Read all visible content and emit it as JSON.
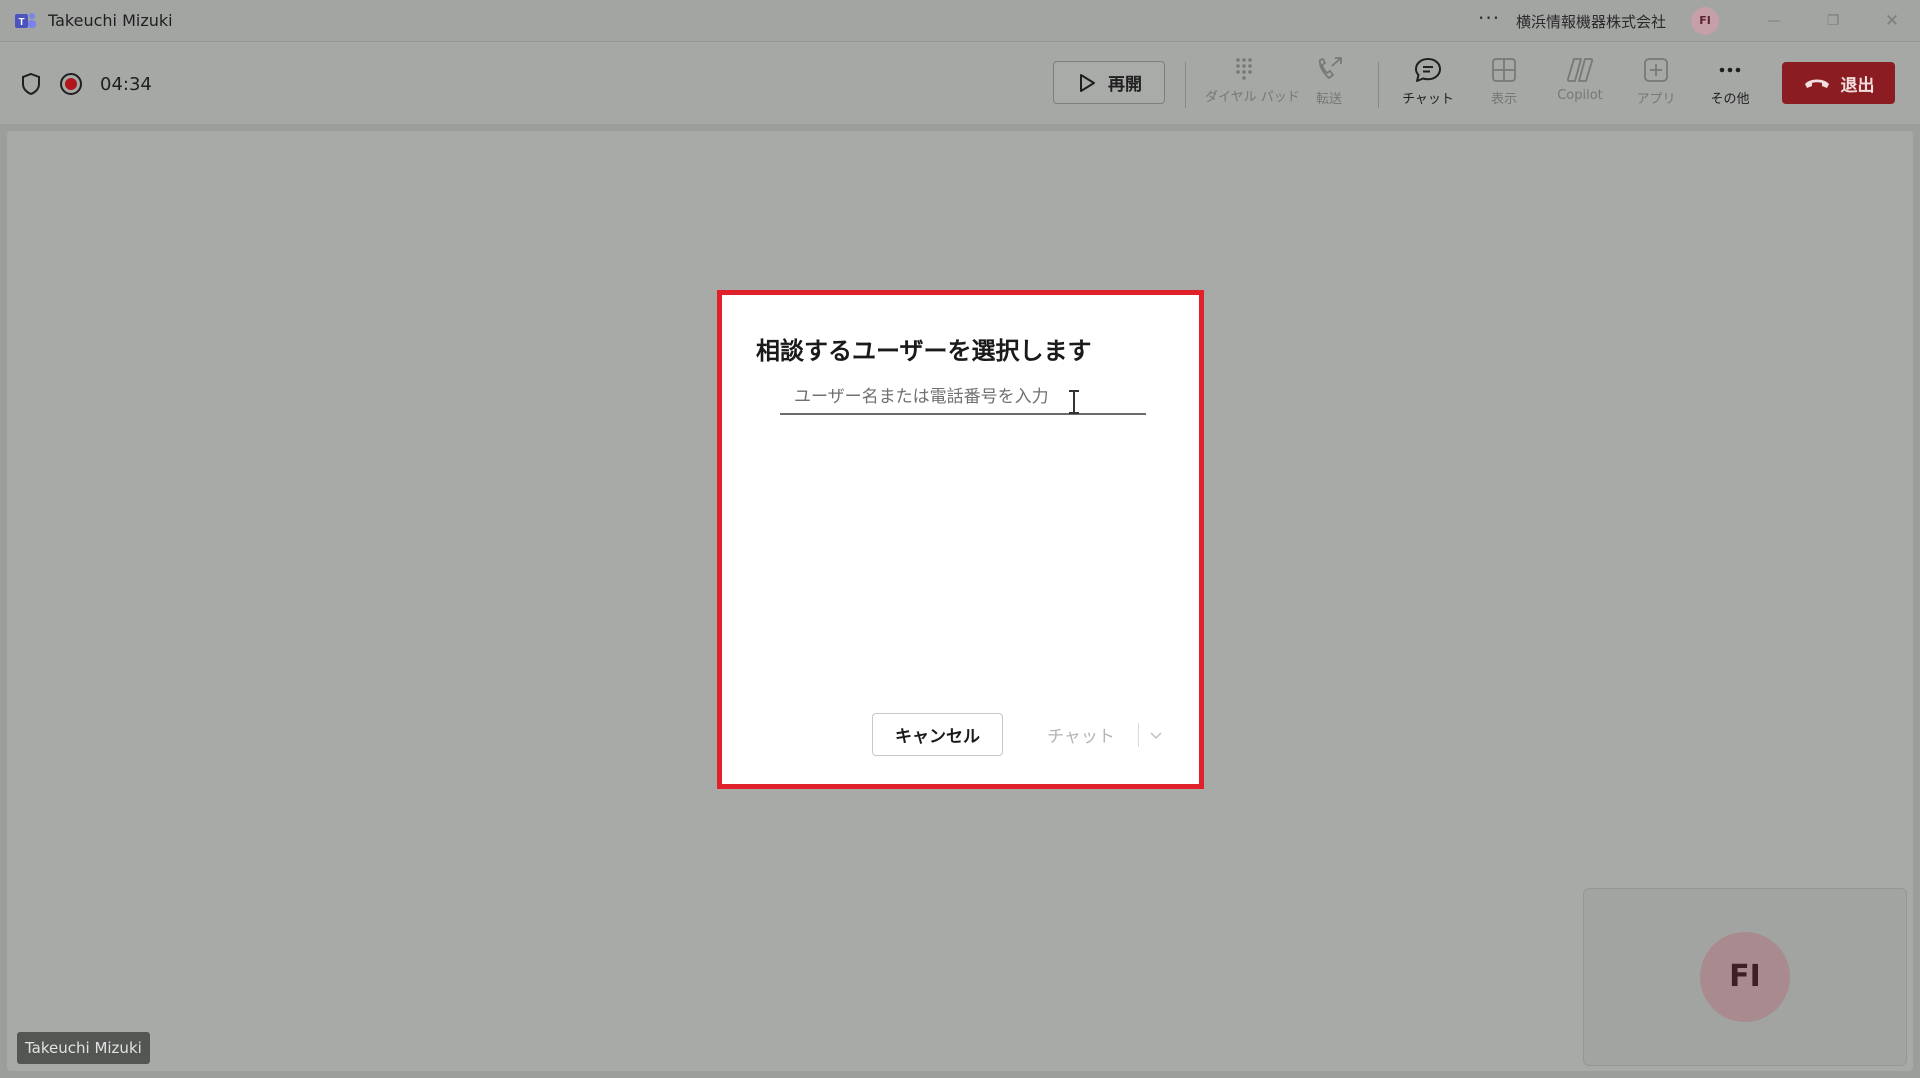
{
  "window": {
    "title": "Takeuchi Mizuki",
    "more": "···",
    "org_name": "横浜情報機器株式会社",
    "org_avatar": "FI",
    "minimize": "—",
    "restore": "❐",
    "close": "✕"
  },
  "toolbar": {
    "timer": "04:34",
    "resume_label": "再開",
    "items": [
      {
        "label": "ダイヤル パッド",
        "icon": "dialpad-icon",
        "enabled": false
      },
      {
        "label": "転送",
        "icon": "transfer-icon",
        "enabled": false
      },
      {
        "label": "チャット",
        "icon": "chat-icon",
        "enabled": true
      },
      {
        "label": "表示",
        "icon": "view-icon",
        "enabled": false
      },
      {
        "label": "Copilot",
        "icon": "copilot-icon",
        "enabled": false
      },
      {
        "label": "アプリ",
        "icon": "apps-icon",
        "enabled": false
      },
      {
        "label": "その他",
        "icon": "more-icon",
        "enabled": true
      }
    ],
    "leave_label": "退出"
  },
  "dialog": {
    "title": "相談するユーザーを選択します",
    "input_placeholder": "ユーザー名または電話番号を入力",
    "input_value": "",
    "cancel_label": "キャンセル",
    "chat_label": "チャット"
  },
  "stage": {
    "self_avatar": "FI",
    "name_tag": "Takeuchi Mizuki"
  },
  "colors": {
    "leave_button": "#8b1d22",
    "dialog_highlight": "#e0202a",
    "avatar": "#a98b8f"
  }
}
